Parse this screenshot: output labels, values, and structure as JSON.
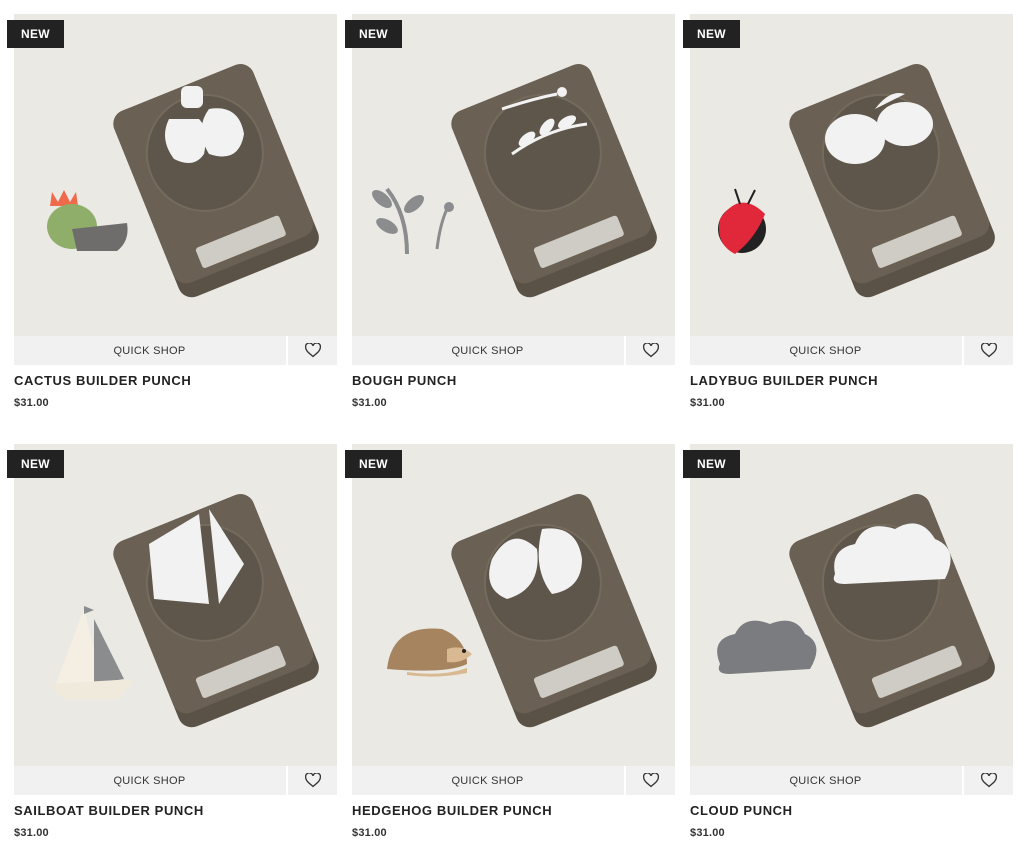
{
  "products": [
    {
      "badge": "NEW",
      "quick_shop": "QUICK SHOP",
      "title": "CACTUS BUILDER PUNCH",
      "price": "$31.00",
      "image_icon": "cactus-icon"
    },
    {
      "badge": "NEW",
      "quick_shop": "QUICK SHOP",
      "title": "BOUGH PUNCH",
      "price": "$31.00",
      "image_icon": "bough-icon"
    },
    {
      "badge": "NEW",
      "quick_shop": "QUICK SHOP",
      "title": "LADYBUG BUILDER PUNCH",
      "price": "$31.00",
      "image_icon": "ladybug-icon"
    },
    {
      "badge": "NEW",
      "quick_shop": "QUICK SHOP",
      "title": "SAILBOAT BUILDER PUNCH",
      "price": "$31.00",
      "image_icon": "sailboat-icon"
    },
    {
      "badge": "NEW",
      "quick_shop": "QUICK SHOP",
      "title": "HEDGEHOG BUILDER PUNCH",
      "price": "$31.00",
      "image_icon": "hedgehog-icon"
    },
    {
      "badge": "NEW",
      "quick_shop": "QUICK SHOP",
      "title": "CLOUD PUNCH",
      "price": "$31.00",
      "image_icon": "cloud-icon"
    }
  ],
  "colors": {
    "badge_bg": "#222222",
    "image_bg": "#ebe9e4",
    "punch_body": "#635a4e",
    "quick_shop_bar": "#f1f1f1"
  },
  "icons": {
    "wishlist": "heart-outline-icon"
  }
}
